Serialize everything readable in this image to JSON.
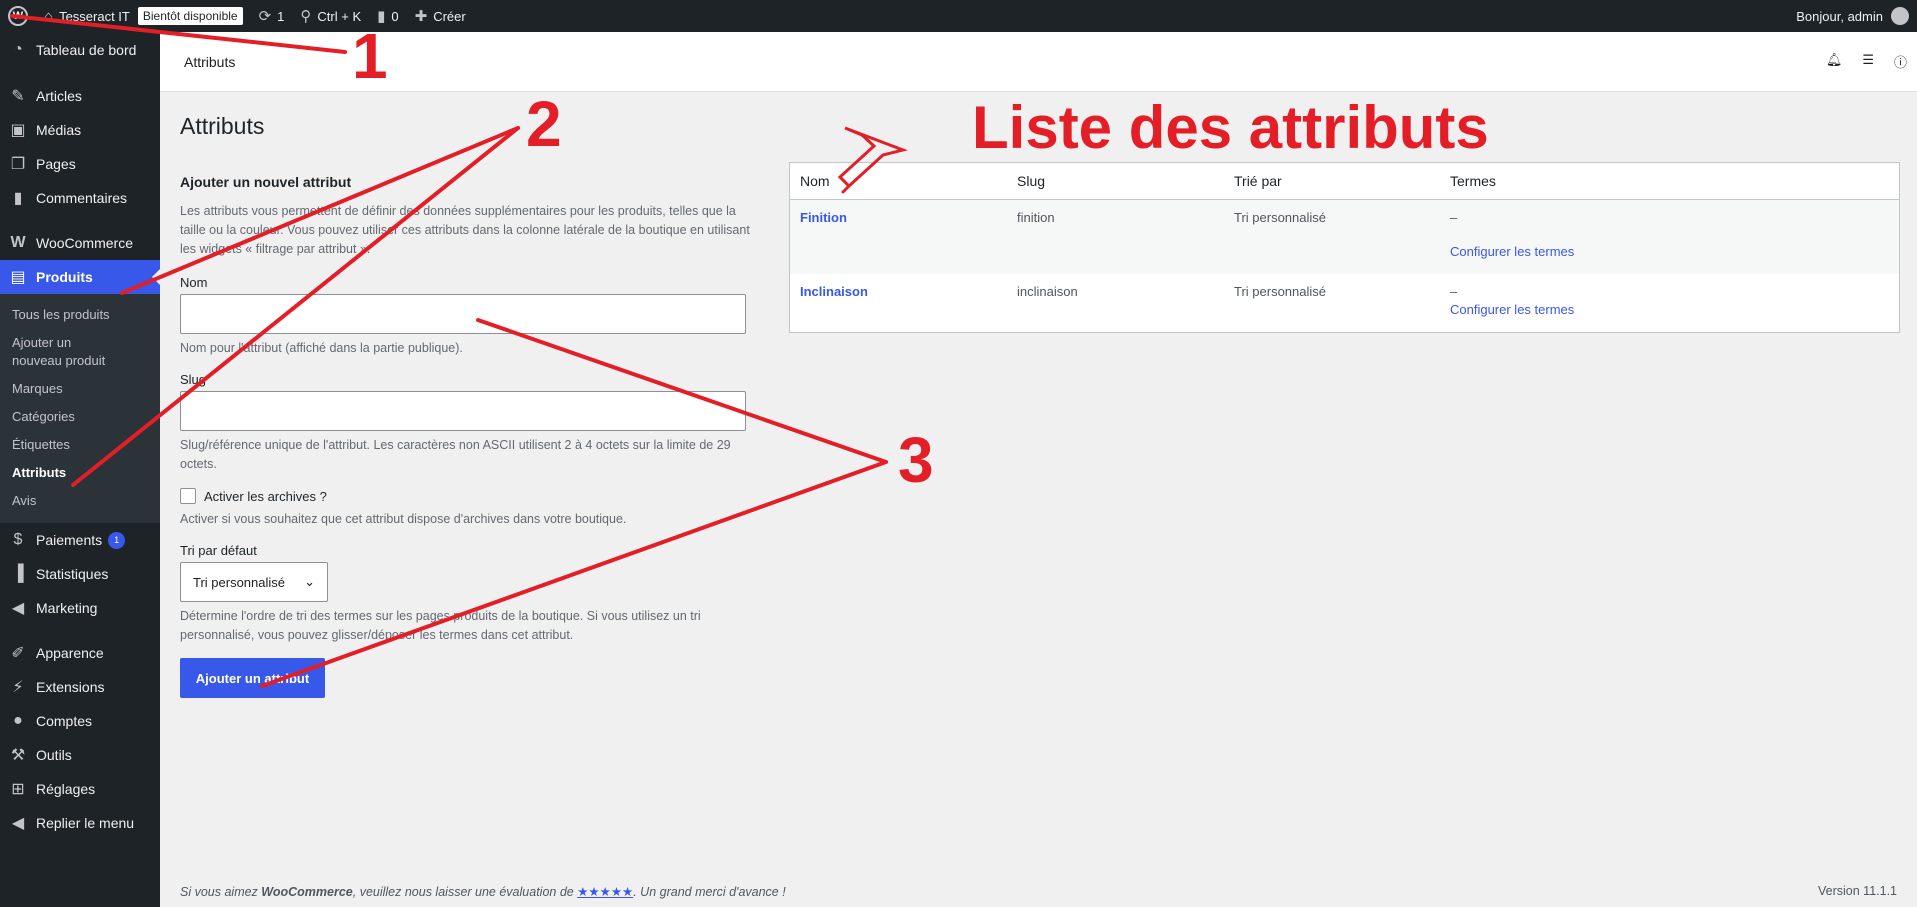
{
  "adminbar": {
    "site_name": "Tesseract IT",
    "soon_badge": "Bientôt disponible",
    "updates_count": "1",
    "search_shortcut": "Ctrl + K",
    "comments_count": "0",
    "create_label": "Créer",
    "greeting": "Bonjour, admin"
  },
  "sidebar": {
    "dashboard": "Tableau de bord",
    "articles": "Articles",
    "medias": "Médias",
    "pages": "Pages",
    "comments": "Commentaires",
    "woocommerce": "WooCommerce",
    "products": "Produits",
    "submenu": {
      "all_products": "Tous les produits",
      "add_new": "Ajouter un nouveau produit",
      "brands": "Marques",
      "categories": "Catégories",
      "tags": "Étiquettes",
      "attributes": "Attributs",
      "reviews": "Avis"
    },
    "payments": "Paiements",
    "payments_badge": "1",
    "statistics": "Statistiques",
    "marketing": "Marketing",
    "appearance": "Apparence",
    "extensions": "Extensions",
    "accounts": "Comptes",
    "tools": "Outils",
    "settings": "Réglages",
    "collapse": "Replier le menu"
  },
  "header": {
    "title": "Attributs"
  },
  "main": {
    "page_title": "Attributs",
    "form": {
      "heading": "Ajouter un nouvel attribut",
      "intro": "Les attributs vous permettent de définir des données supplémentaires pour les produits, telles que la taille ou la couleur. Vous pouvez utiliser ces attributs dans la colonne latérale de la boutique en utilisant les widgets « filtrage par attribut ».",
      "name_label": "Nom",
      "name_value": "",
      "name_help": "Nom pour l'attribut (affiché dans la partie publique).",
      "slug_label": "Slug",
      "slug_value": "",
      "slug_help": "Slug/référence unique de l'attribut. Les caractères non ASCII utilisent 2 à 4 octets sur la limite de 29 octets.",
      "archives_label": "Activer les archives ?",
      "archives_help": "Activer si vous souhaitez que cet attribut dispose d'archives dans votre boutique.",
      "sort_label": "Tri par défaut",
      "sort_value": "Tri personnalisé",
      "sort_help": "Détermine l'ordre de tri des termes sur les pages produits de la boutique. Si vous utilisez un tri personnalisé, vous pouvez glisser/déposer les termes dans cet attribut.",
      "submit_label": "Ajouter un attribut"
    },
    "table": {
      "headers": [
        "Nom",
        "Slug",
        "Trié par",
        "Termes"
      ],
      "rows": [
        {
          "name": "Finition",
          "slug": "finition",
          "sort": "Tri personnalisé",
          "terms": "–",
          "action": "Configurer les termes"
        },
        {
          "name": "Inclinaison",
          "slug": "inclinaison",
          "sort": "Tri personnalisé",
          "terms": "–",
          "action": "Configurer les termes"
        }
      ]
    }
  },
  "footer": {
    "text_before": "Si vous aimez ",
    "brand": "WooCommerce",
    "text_middle": ", veuillez nous laisser une évaluation de ",
    "stars": "★★★★★",
    "text_after": ". Un grand merci d'avance !",
    "version": "Version 11.1.1"
  },
  "annotations": {
    "label_1": "1",
    "label_2": "2",
    "label_3": "3",
    "title": "Liste des attributs",
    "color": "#e41e26"
  }
}
